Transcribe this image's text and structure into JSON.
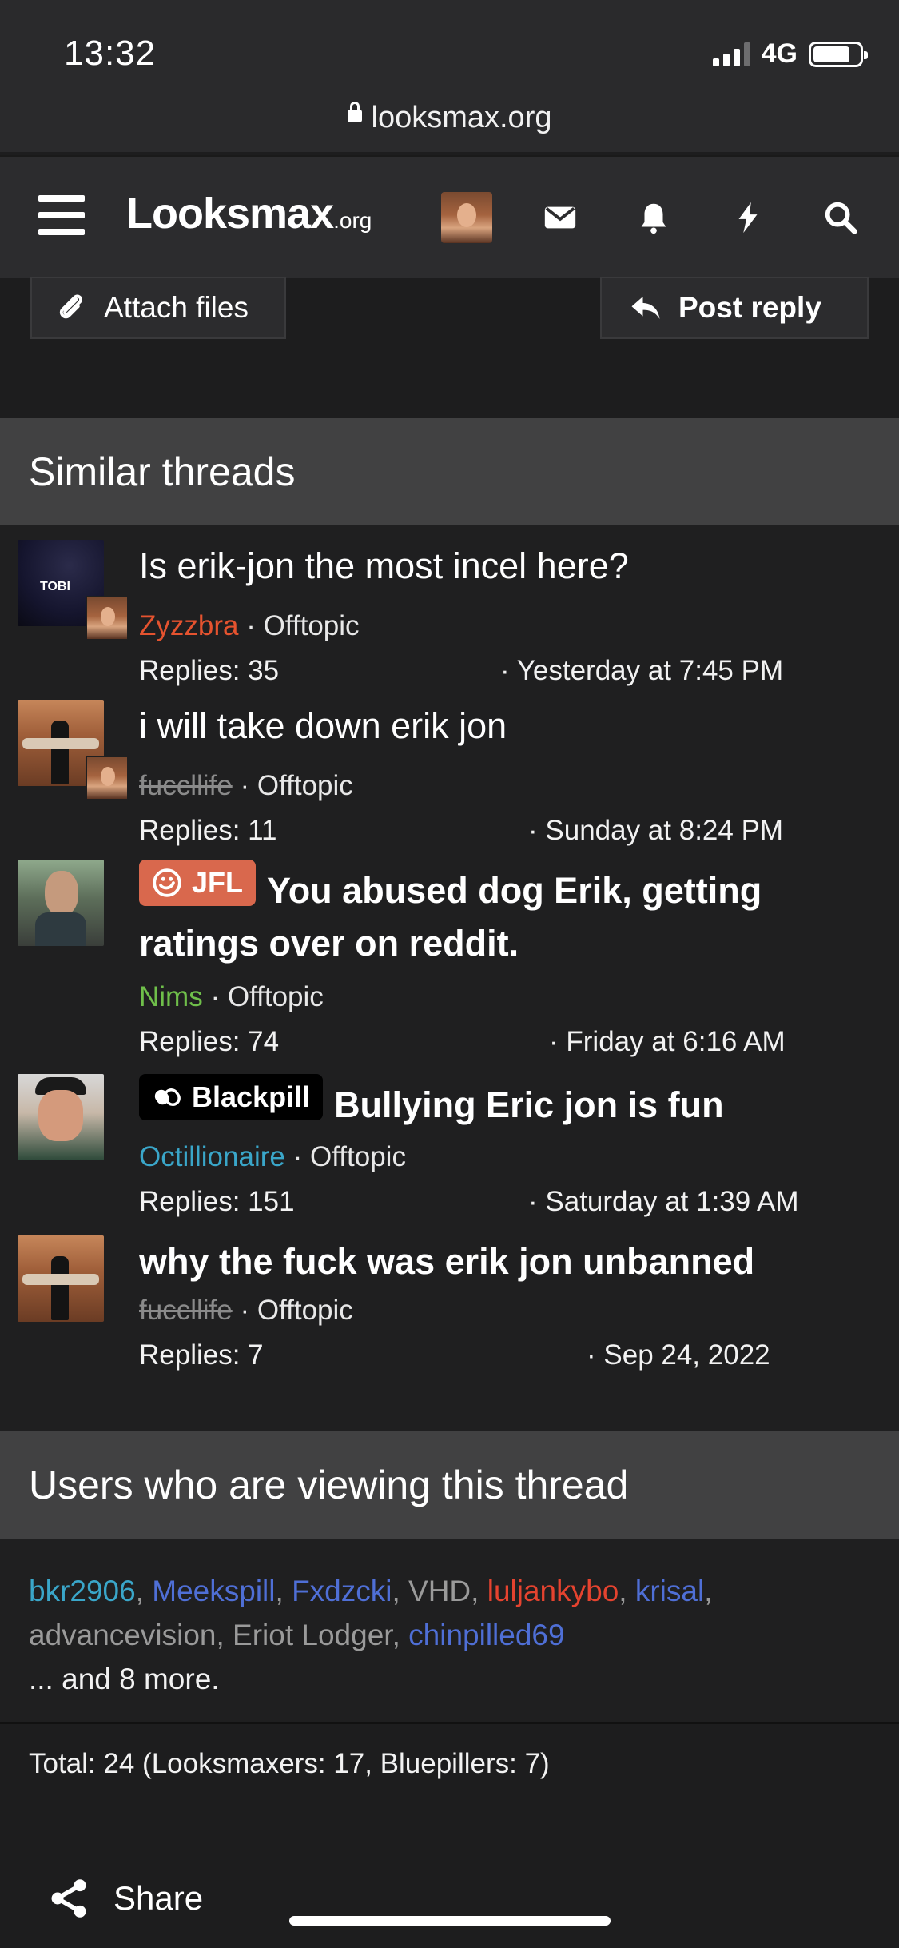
{
  "status": {
    "time": "13:32",
    "network": "4G"
  },
  "browser": {
    "url": "looksmax.org"
  },
  "header": {
    "logo_main": "Looksmax",
    "logo_suffix": ".org"
  },
  "reply_bar": {
    "attach_label": "Attach files",
    "reply_label": "Post reply"
  },
  "similar": {
    "title": "Similar threads",
    "threads": [
      {
        "title": "Is erik-jon the most incel here?",
        "author": "Zyzzbra",
        "author_color": "#e5532f",
        "forum": "· Offtopic",
        "replies": "Replies: 35",
        "date": "· Yesterday at 7:45 PM"
      },
      {
        "title": "i will take down erik jon",
        "author": "fuccllife",
        "author_color": "#8a8a8a",
        "forum": "· Offtopic",
        "replies": "Replies: 11",
        "date": "· Sunday at 8:24 PM"
      },
      {
        "prefix": "JFL",
        "prefix_color": "#d9684d",
        "title": "You abused dog Erik, getting ratings over on reddit.",
        "author": "Nims",
        "author_color": "#6fbf4a",
        "forum": "· Offtopic",
        "replies": "Replies: 74",
        "date": "· Friday at 6:16 AM"
      },
      {
        "prefix": "Blackpill",
        "prefix_color": "#000000",
        "title": "Bullying Eric jon is fun",
        "author": "Octillionaire",
        "author_color": "#3aa6c9",
        "forum": "· Offtopic",
        "replies": "Replies: 151",
        "date": "· Saturday at 1:39 AM"
      },
      {
        "title": "why the fuck was erik jon unbanned",
        "author": "fuccllife",
        "author_color": "#8a8a8a",
        "forum": "· Offtopic",
        "replies": "Replies: 7",
        "date": "· Sep 24, 2022"
      }
    ]
  },
  "viewing": {
    "title": "Users who are viewing this thread",
    "users": [
      {
        "name": "bkr2906",
        "color": "#3aa6c9"
      },
      {
        "name": "Meekspill",
        "color": "#4f6fd6"
      },
      {
        "name": "Fxdzcki",
        "color": "#4f6fd6"
      },
      {
        "name": "VHD",
        "color": "#9a9a9a"
      },
      {
        "name": "luljankybo",
        "color": "#e5432f"
      },
      {
        "name": "krisal",
        "color": "#4f6fd6"
      },
      {
        "name": "advancevision",
        "color": "#9a9a9a"
      },
      {
        "name": "Eriot Lodger",
        "color": "#9a9a9a"
      },
      {
        "name": "chinpilled69",
        "color": "#4f6fd6"
      }
    ],
    "more": "... and 8 more.",
    "total": "Total: 24 (Looksmaxers: 17, Bluepillers: 7)"
  },
  "footer": {
    "share_label": "Share"
  },
  "icons": [
    "menu-icon",
    "mail-icon",
    "bell-icon",
    "bolt-icon",
    "search-icon",
    "paperclip-icon",
    "reply-arrow-icon",
    "share-icon",
    "lock-icon"
  ]
}
